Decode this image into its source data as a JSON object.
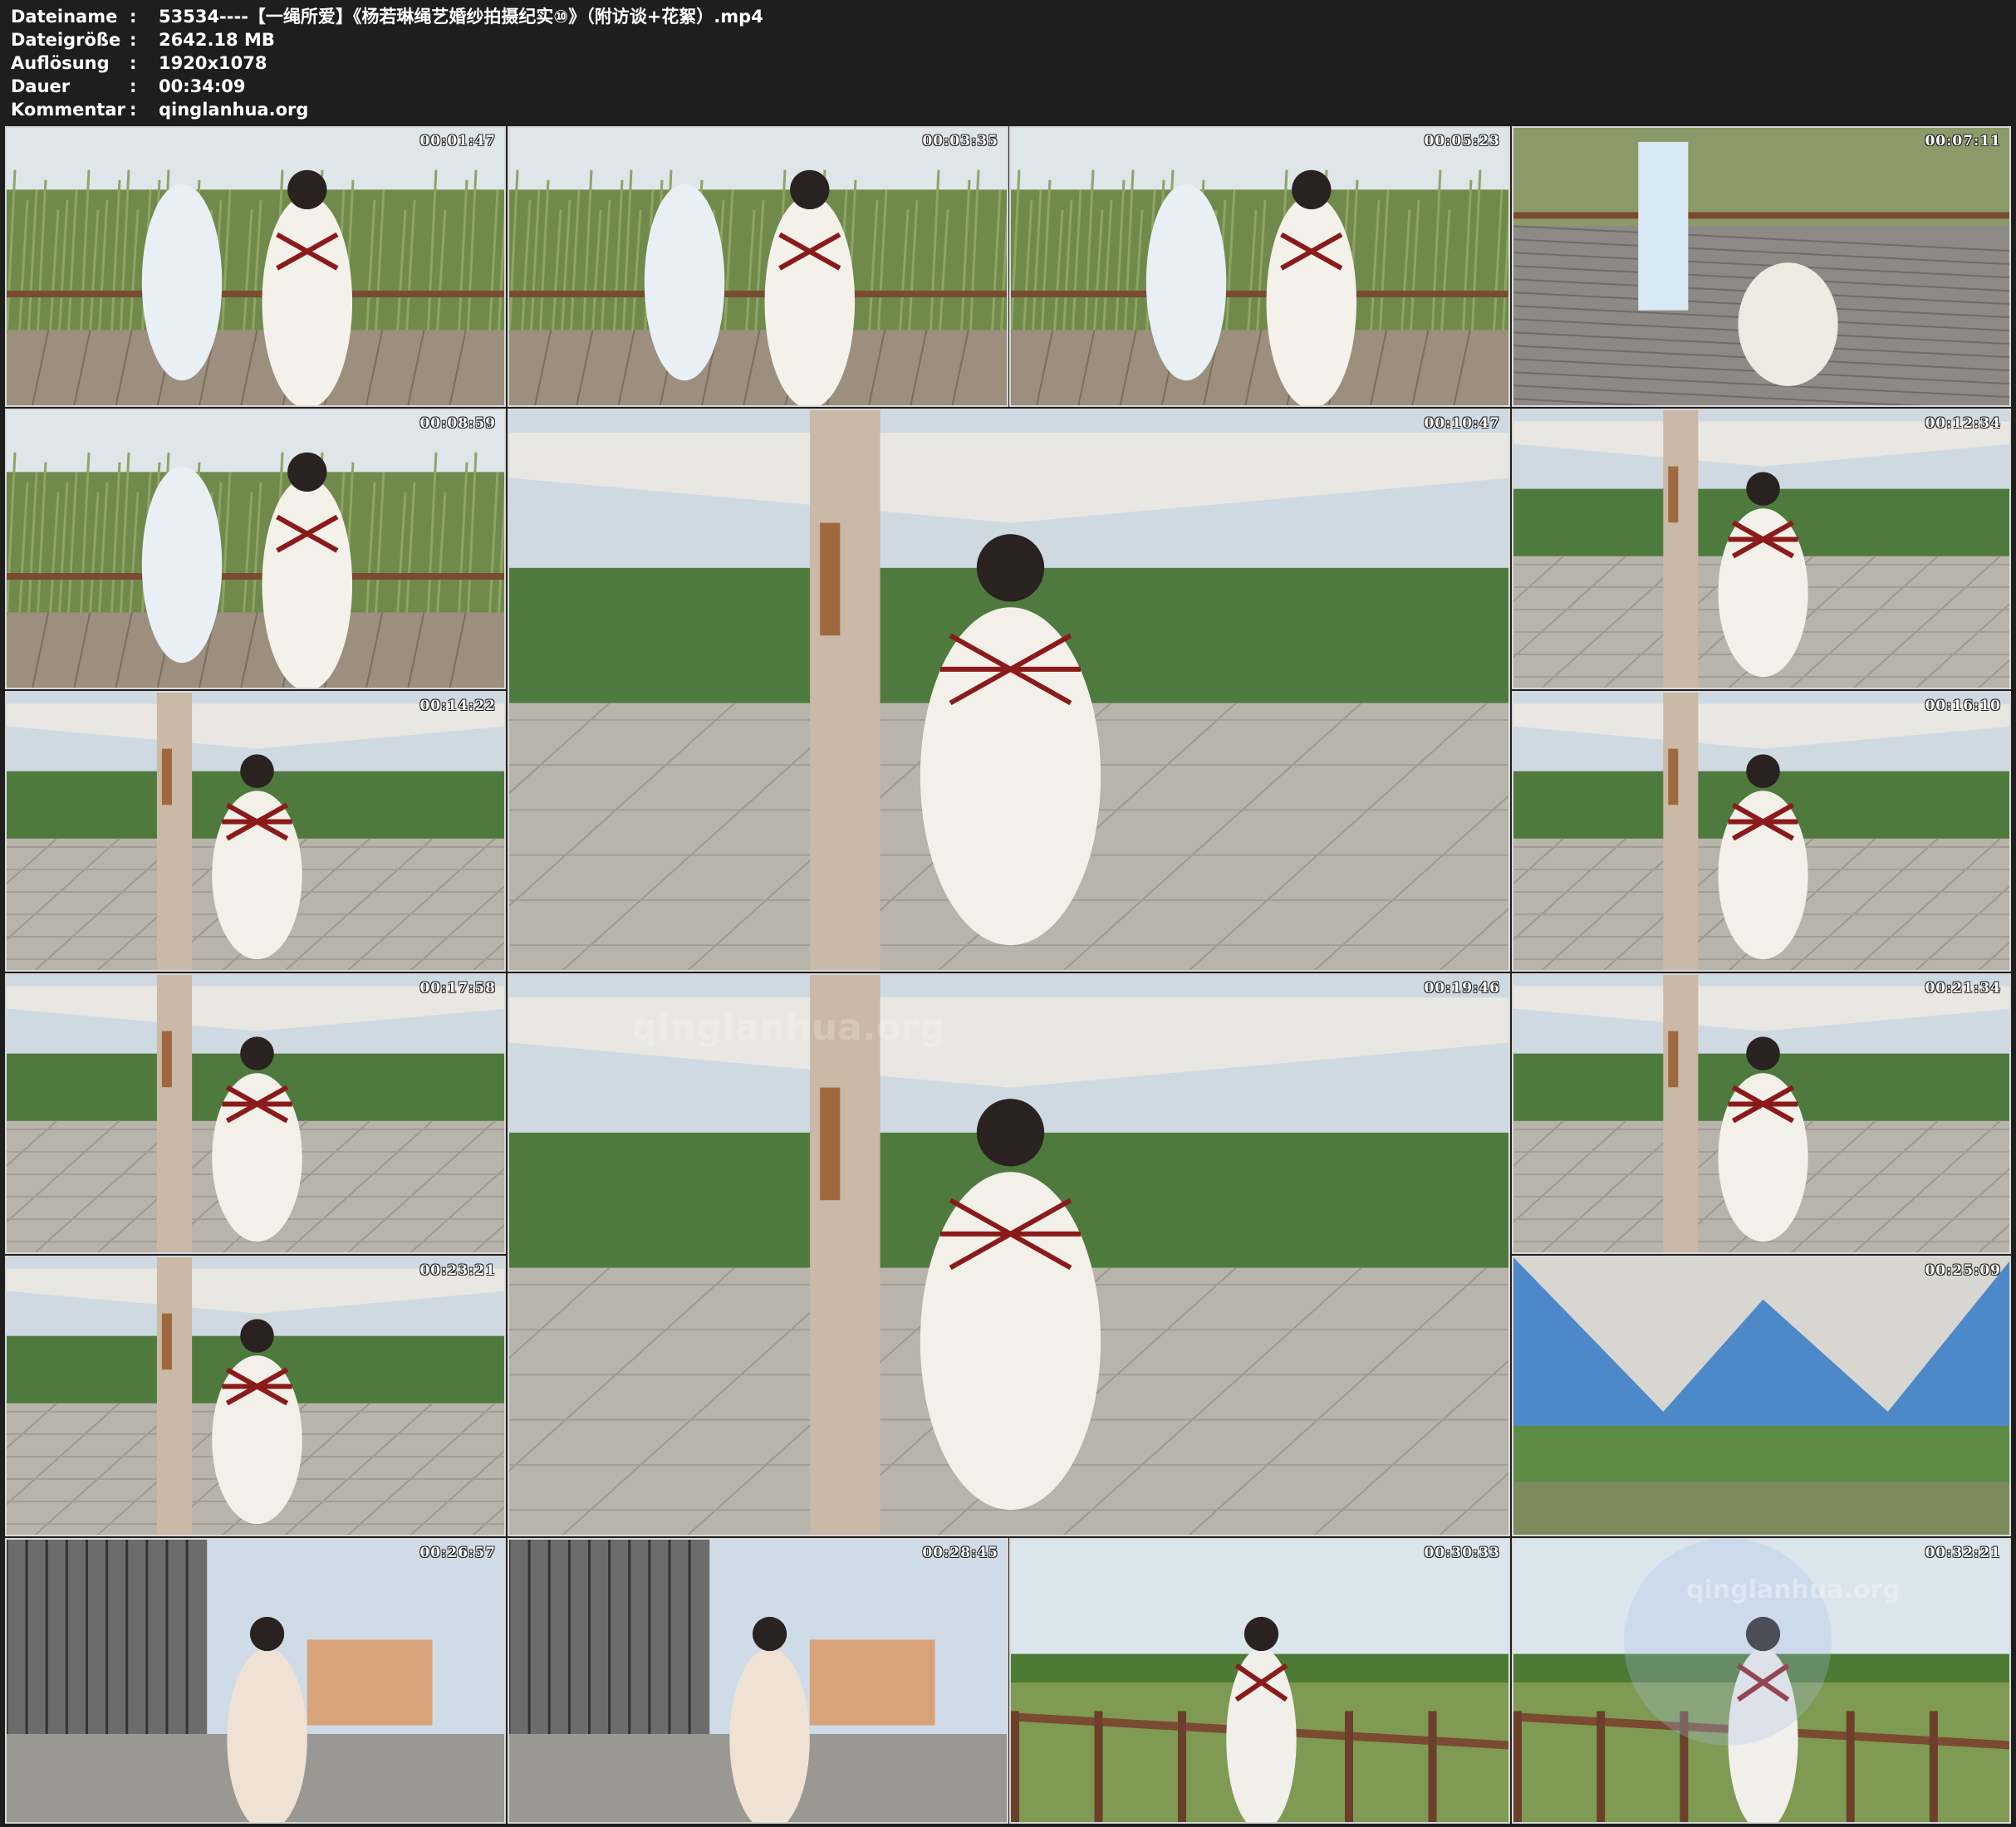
{
  "info": [
    {
      "key": "Dateiname",
      "sep": ":",
      "value": "53534----【一绳所爱】《杨若琳绳艺婚纱拍摄纪实⑩》（附访谈+花絮）.mp4"
    },
    {
      "key": "Dateigröße",
      "sep": ":",
      "value": "2642.18 MB"
    },
    {
      "key": "Auflösung",
      "sep": ":",
      "value": "1920x1078"
    },
    {
      "key": "Dauer",
      "sep": ":",
      "value": "00:34:09"
    },
    {
      "key": "Kommentar",
      "sep": ":",
      "value": "qinglanhua.org"
    }
  ],
  "thumbnails": [
    {
      "timestamp": "00:01:47",
      "scene": "wetland-boardwalk"
    },
    {
      "timestamp": "00:03:35",
      "scene": "wetland-boardwalk"
    },
    {
      "timestamp": "00:05:23",
      "scene": "wetland-boardwalk"
    },
    {
      "timestamp": "00:07:11",
      "scene": "boardwalk-deck"
    },
    {
      "timestamp": "00:08:59",
      "scene": "reeds-sky"
    },
    {
      "timestamp": "00:10:47",
      "scene": "plaza-canopy"
    },
    {
      "timestamp": "00:12:34",
      "scene": "plaza-pole"
    },
    {
      "timestamp": "00:14:22",
      "scene": "plaza-pole"
    },
    {
      "timestamp": "00:16:10",
      "scene": "plaza-pole"
    },
    {
      "timestamp": "00:17:58",
      "scene": "plaza-pole"
    },
    {
      "timestamp": "00:19:46",
      "scene": "plaza-canopy"
    },
    {
      "timestamp": "00:21:34",
      "scene": "plaza-pole"
    },
    {
      "timestamp": "00:23:21",
      "scene": "plaza-pole"
    },
    {
      "timestamp": "00:25:09",
      "scene": "canopy-sky"
    },
    {
      "timestamp": "00:26:57",
      "scene": "city-street"
    },
    {
      "timestamp": "00:28:45",
      "scene": "city-street"
    },
    {
      "timestamp": "00:30:33",
      "scene": "wetland-fence"
    },
    {
      "timestamp": "00:32:21",
      "scene": "wetland-fence"
    }
  ],
  "watermarks": [
    "qinglanhua.org",
    "qinglanhua.org"
  ],
  "colors": {
    "background": "#1e1e1e",
    "text": "#ffffff",
    "thumb_border": "#d8d8d8",
    "rope": "#8b1a1a"
  }
}
